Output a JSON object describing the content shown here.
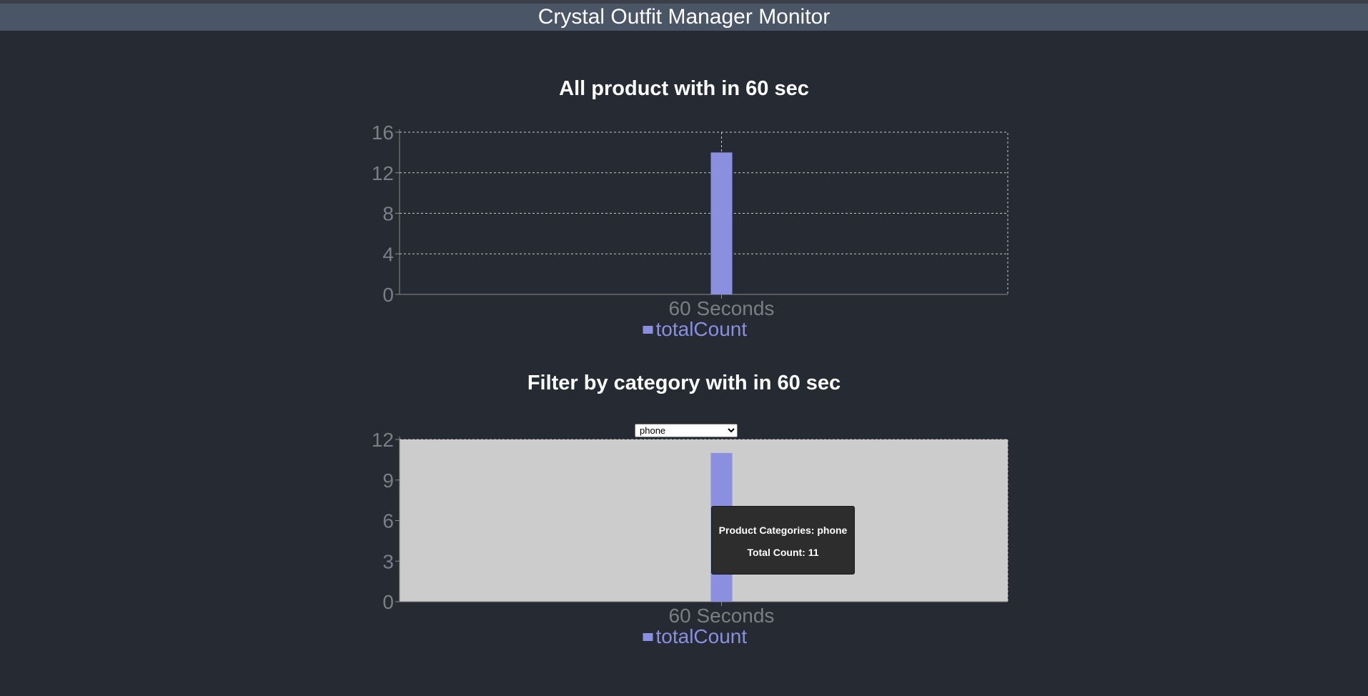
{
  "header": {
    "title": "Crystal Outfit Manager Monitor"
  },
  "sections": [
    {
      "title": "All product with in 60 sec"
    },
    {
      "title": "Filter by category with in 60 sec"
    }
  ],
  "filter": {
    "selected": "phone",
    "options": [
      "phone"
    ]
  },
  "tooltip": {
    "line1": "Product Categories: phone",
    "line2": "Total Count: 11"
  },
  "colors": {
    "bar": "#8a8fe0",
    "legend": "#8a8fe0",
    "plot_bg_filter": "#cccccc"
  },
  "chart_data": [
    {
      "type": "bar",
      "categories": [
        "60 Seconds"
      ],
      "series": [
        {
          "name": "totalCount",
          "values": [
            14
          ]
        }
      ],
      "ylim": [
        0,
        16
      ],
      "yticks": [
        0,
        4,
        8,
        12,
        16
      ],
      "grid": true,
      "legend": "bottom"
    },
    {
      "type": "bar",
      "categories": [
        "60 Seconds"
      ],
      "series": [
        {
          "name": "totalCount",
          "values": [
            11
          ]
        }
      ],
      "ylim": [
        0,
        12
      ],
      "yticks": [
        0,
        3,
        6,
        9,
        12
      ],
      "grid": false,
      "legend": "bottom"
    }
  ]
}
